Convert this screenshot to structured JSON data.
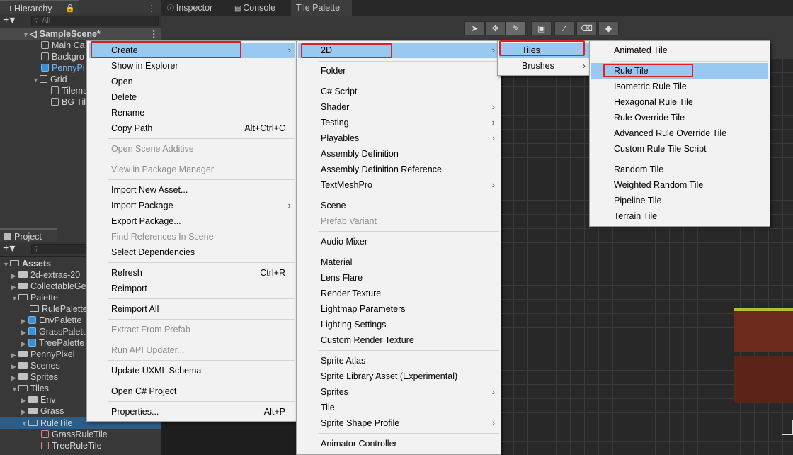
{
  "hierarchy": {
    "tab": "Hierarchy",
    "search_placeholder": "All",
    "scene": "SampleScene*",
    "items": [
      "Main Ca",
      "Backgro",
      "PennyPi",
      "Grid",
      "Tilema",
      "BG Til"
    ]
  },
  "top_tabs": [
    "Inspector",
    "Console",
    "Tile Palette"
  ],
  "project": {
    "tab": "Project",
    "items": [
      "Assets",
      "2d-extras-20",
      "CollectableGe",
      "Palette",
      "RulePalette",
      "EnvPalette",
      "GrassPalett",
      "TreePalette",
      "PennyPixel",
      "Scenes",
      "Sprites",
      "Tiles",
      "Env",
      "Grass",
      "RuleTile",
      "GrassRuleTile",
      "TreeRuleTile"
    ]
  },
  "context_menu": {
    "items": [
      {
        "label": "Create",
        "submenu": true
      },
      {
        "label": "Show in Explorer"
      },
      {
        "label": "Open"
      },
      {
        "label": "Delete"
      },
      {
        "label": "Rename"
      },
      {
        "label": "Copy Path",
        "shortcut": "Alt+Ctrl+C"
      },
      {
        "label": "Open Scene Additive"
      },
      {
        "label": "View in Package Manager"
      },
      {
        "label": "Import New Asset..."
      },
      {
        "label": "Import Package",
        "submenu": true
      },
      {
        "label": "Export Package..."
      },
      {
        "label": "Find References In Scene"
      },
      {
        "label": "Select Dependencies"
      },
      {
        "label": "Refresh",
        "shortcut": "Ctrl+R"
      },
      {
        "label": "Reimport"
      },
      {
        "label": "Reimport All"
      },
      {
        "label": "Extract From Prefab"
      },
      {
        "label": "Run API Updater..."
      },
      {
        "label": "Update UXML Schema"
      },
      {
        "label": "Open C# Project"
      },
      {
        "label": "Properties...",
        "shortcut": "Alt+P"
      }
    ]
  },
  "create_menu": {
    "items": [
      {
        "label": "2D",
        "submenu": true
      },
      {
        "label": "Folder"
      },
      {
        "label": "C# Script"
      },
      {
        "label": "Shader",
        "submenu": true
      },
      {
        "label": "Testing",
        "submenu": true
      },
      {
        "label": "Playables",
        "submenu": true
      },
      {
        "label": "Assembly Definition"
      },
      {
        "label": "Assembly Definition Reference"
      },
      {
        "label": "TextMeshPro",
        "submenu": true
      },
      {
        "label": "Scene"
      },
      {
        "label": "Prefab Variant"
      },
      {
        "label": "Audio Mixer"
      },
      {
        "label": "Material"
      },
      {
        "label": "Lens Flare"
      },
      {
        "label": "Render Texture"
      },
      {
        "label": "Lightmap Parameters"
      },
      {
        "label": "Lighting Settings"
      },
      {
        "label": "Custom Render Texture"
      },
      {
        "label": "Sprite Atlas"
      },
      {
        "label": "Sprite Library Asset (Experimental)"
      },
      {
        "label": "Sprites",
        "submenu": true
      },
      {
        "label": "Tile"
      },
      {
        "label": "Sprite Shape Profile",
        "submenu": true
      },
      {
        "label": "Animator Controller"
      }
    ]
  },
  "twod_menu": {
    "items": [
      {
        "label": "Tiles",
        "submenu": true
      },
      {
        "label": "Brushes",
        "submenu": true
      }
    ]
  },
  "tiles_menu": {
    "items": [
      {
        "label": "Animated Tile"
      },
      {
        "label": "Rule Tile"
      },
      {
        "label": "Isometric Rule Tile"
      },
      {
        "label": "Hexagonal Rule Tile"
      },
      {
        "label": "Rule Override Tile"
      },
      {
        "label": "Advanced Rule Override Tile"
      },
      {
        "label": "Custom Rule Tile Script"
      },
      {
        "label": "Random Tile"
      },
      {
        "label": "Weighted Random Tile"
      },
      {
        "label": "Pipeline Tile"
      },
      {
        "label": "Terrain Tile"
      }
    ]
  },
  "colors": {
    "highlight": "#99c9f0",
    "annotation": "#e02020",
    "selection": "#2c5d87"
  }
}
